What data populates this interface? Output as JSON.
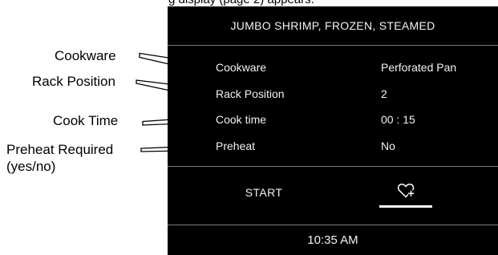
{
  "caption": {
    "top_text": "g display (page 2) appears."
  },
  "callouts": {
    "cookware": "Cookware",
    "rack_position": "Rack Position",
    "cook_time": "Cook Time",
    "preheat_required": "Preheat Required",
    "preheat_note": "(yes/no)"
  },
  "screen": {
    "title": "JUMBO SHRIMP, FROZEN, STEAMED",
    "rows": [
      {
        "label": "Cookware",
        "value": "Perforated Pan"
      },
      {
        "label": "Rack Position",
        "value": "2"
      },
      {
        "label": "Cook time",
        "value": "00 : 15"
      },
      {
        "label": "Preheat",
        "value": "No"
      }
    ],
    "start_label": "START",
    "favorite_icon": "heart-plus-icon",
    "clock": "10:35 AM"
  },
  "colors": {
    "screen_background": "#000000",
    "screen_text": "#f2f2f2",
    "divider": "#7a7a7a",
    "page_background": "#ffffff"
  }
}
